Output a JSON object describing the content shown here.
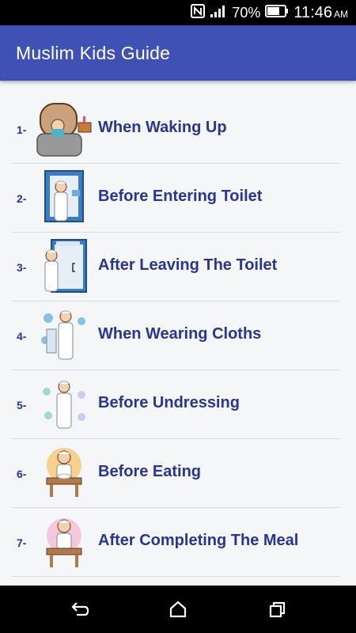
{
  "status_bar": {
    "battery_percent": "70%",
    "time": "11:46",
    "ampm": "AM",
    "icons": [
      "nfc-icon",
      "signal-icon",
      "battery-icon"
    ]
  },
  "app_bar": {
    "title": "Muslim Kids Guide"
  },
  "duas": [
    {
      "number": "1-",
      "label": "When Waking Up",
      "icon": "waking-up-illustration"
    },
    {
      "number": "2-",
      "label": "Before Entering Toilet",
      "icon": "entering-toilet-illustration"
    },
    {
      "number": "3-",
      "label": "After Leaving The Toilet",
      "icon": "leaving-toilet-illustration"
    },
    {
      "number": "4-",
      "label": "When Wearing Cloths",
      "icon": "wearing-clothes-illustration"
    },
    {
      "number": "5-",
      "label": "Before Undressing",
      "icon": "undressing-illustration"
    },
    {
      "number": "6-",
      "label": "Before Eating",
      "icon": "eating-illustration"
    },
    {
      "number": "7-",
      "label": "After Completing The Meal",
      "icon": "after-meal-illustration"
    }
  ],
  "nav_bar": {
    "buttons": [
      "back-icon",
      "home-icon",
      "recents-icon"
    ]
  },
  "colors": {
    "app_bar": "#3f51b5",
    "text_accent": "#283593",
    "background": "#f5f6f8"
  }
}
